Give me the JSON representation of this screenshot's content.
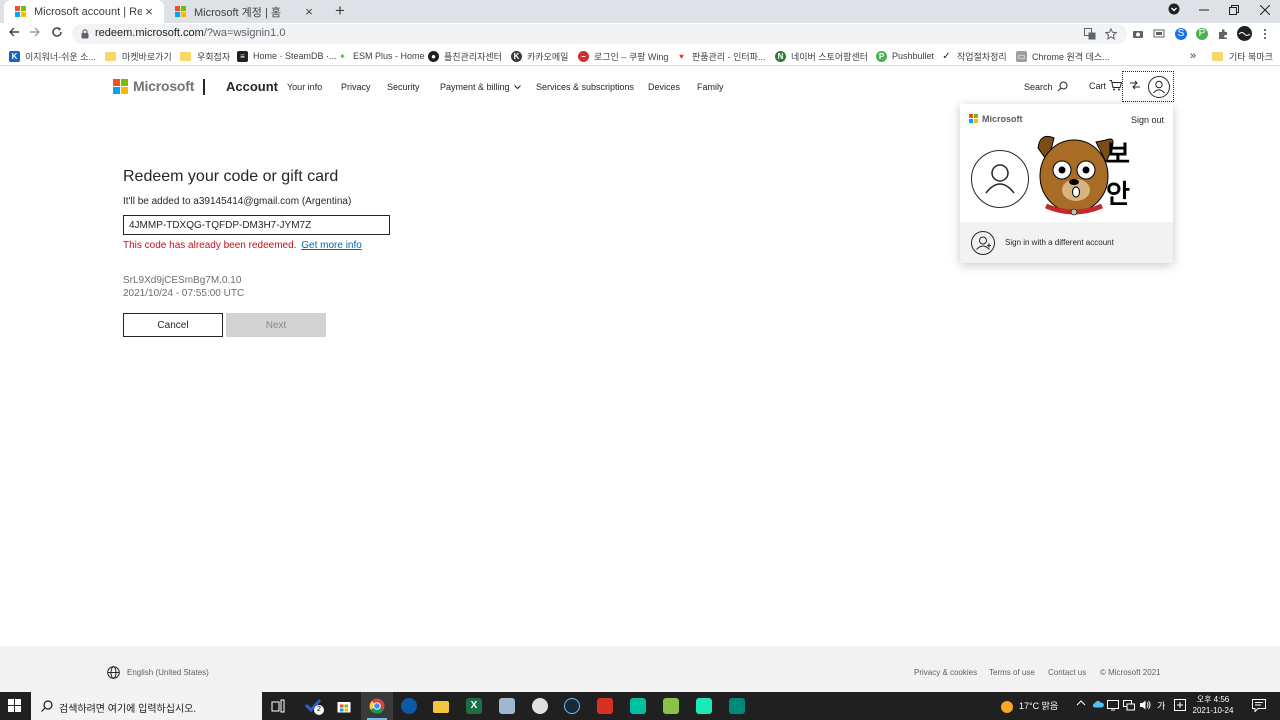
{
  "browser": {
    "tabs": [
      {
        "title": "Microsoft account | Redeem",
        "active": true
      },
      {
        "title": "Microsoft 계정 | 홈",
        "active": false
      }
    ],
    "new_tab_glyph": "+",
    "close_glyph": "×",
    "url_host": "redeem.microsoft.com",
    "url_path": "/?wa=wsignin1.0",
    "bookmarks": [
      {
        "label": "이지워너-쉬운 소...",
        "icon": "ezwon-icon"
      },
      {
        "label": "마켓바로가기",
        "icon": "folder-icon"
      },
      {
        "label": "우회접자",
        "icon": "folder-icon"
      },
      {
        "label": "Home · SteamDB ·...",
        "icon": "steamdb-icon"
      },
      {
        "label": "ESM Plus - Home",
        "icon": "esm-icon"
      },
      {
        "label": "플친관리자센터",
        "icon": "kakao-plus-icon"
      },
      {
        "label": "카카오메일",
        "icon": "kakao-mail-icon"
      },
      {
        "label": "로그인 – 쿠팡 Wing",
        "icon": "coupang-icon"
      },
      {
        "label": "판품관리 - 인터파...",
        "icon": "heart-icon"
      },
      {
        "label": "네이버 스토어팜센터",
        "icon": "naver-icon"
      },
      {
        "label": "Pushbullet",
        "icon": "pushbullet-icon"
      },
      {
        "label": "작업절차정리",
        "icon": "check-icon"
      },
      {
        "label": "Chrome 원격 데스...",
        "icon": "remote-desktop-icon"
      }
    ],
    "bookmarks_overflow": "»",
    "other_bookmarks": "기타 북마크"
  },
  "header": {
    "brand": "Microsoft",
    "section": "Account",
    "nav": [
      "Your info",
      "Privacy",
      "Security",
      "Payment & billing",
      "Services & subscriptions",
      "Devices",
      "Family"
    ],
    "search": "Search",
    "cart": "Cart"
  },
  "redeem": {
    "title": "Redeem your code or gift card",
    "subtitle": "It'll be added to a39145414@gmail.com (Argentina)",
    "code": "4JMMP-TDXQG-TQFDP-DM3H7-JYM7Z",
    "error": "This code has already been redeemed.",
    "error_link": "Get more info",
    "meta_id": "SrL9Xd9jCESmBg7M.0.10",
    "meta_time": "2021/10/24 - 07:55:00 UTC",
    "cancel": "Cancel",
    "next": "Next"
  },
  "flyout": {
    "brand": "Microsoft",
    "sign_out": "Sign out",
    "sticker_text_1": "보",
    "sticker_text_2": "안",
    "switch_account": "Sign in with a different account"
  },
  "footer": {
    "language": "English (United States)",
    "links": [
      "Privacy & cookies",
      "Terms of use",
      "Contact us",
      "© Microsoft 2021"
    ]
  },
  "taskbar": {
    "search_placeholder": "검색하려면 여기에 입력하십시오.",
    "weather": "17°C 맑음",
    "ime": "가",
    "time": "오후 4:56",
    "date": "2021-10-24",
    "todo_badge": "2"
  },
  "colors": {
    "ms_red": "#f25022",
    "ms_green": "#7fba00",
    "ms_blue": "#00a4ef",
    "ms_yellow": "#ffb900",
    "error": "#c50f1f",
    "link": "#0067b8"
  }
}
